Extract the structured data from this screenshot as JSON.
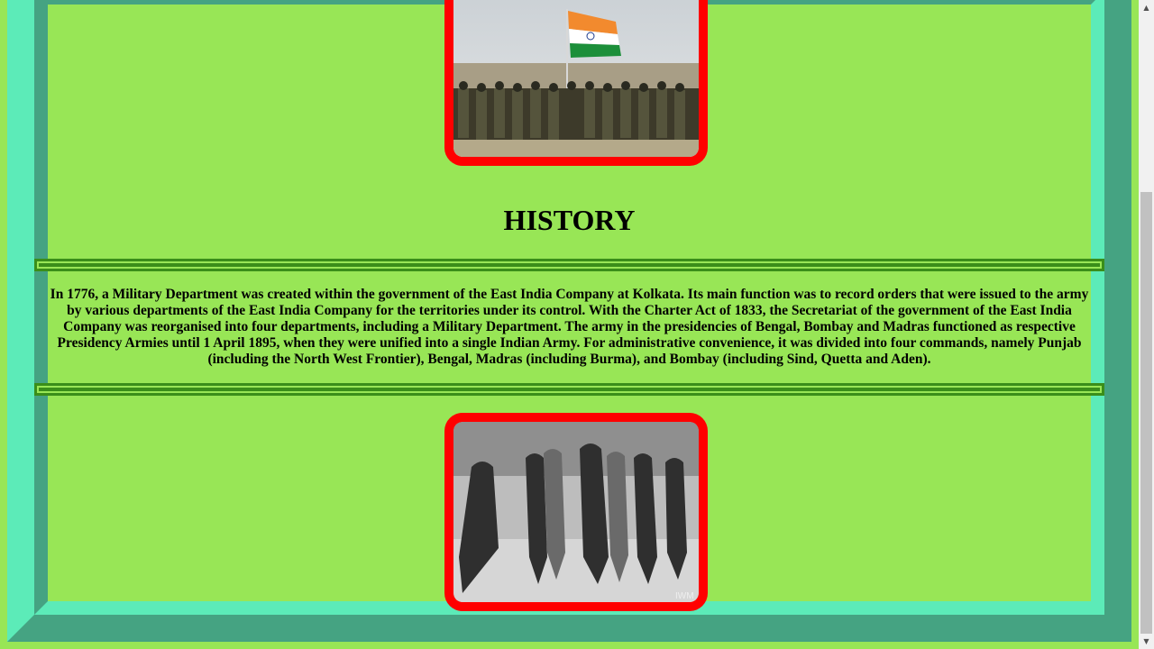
{
  "history": {
    "heading": "HISTORY",
    "paragraph": "In 1776, a Military Department was created within the government of the East India Company at Kolkata. Its main function was to record orders that were issued to the army by various departments of the East India Company for the territories under its control. With the Charter Act of 1833, the Secretariat of the government of the East India Company was reorganised into four departments, including a Military Department. The army in the presidencies of Bengal, Bombay and Madras functioned as respective Presidency Armies until 1 April 1895, when they were unified into a single Indian Army. For administrative convenience, it was divided into four commands, namely Punjab (including the North West Frontier), Bengal, Madras (including Burma), and Bombay (including Sind, Quetta and Aden)."
  },
  "images": {
    "bottom_watermark": "IWM"
  },
  "colors": {
    "page_background": "#98e656",
    "frame_light": "#5cebb8",
    "frame_dark": "#45a382",
    "image_border": "#ff0000",
    "rule": "#3a8e1a"
  },
  "scrollbar": {
    "up_icon": "triangle-up",
    "down_icon": "triangle-down"
  }
}
